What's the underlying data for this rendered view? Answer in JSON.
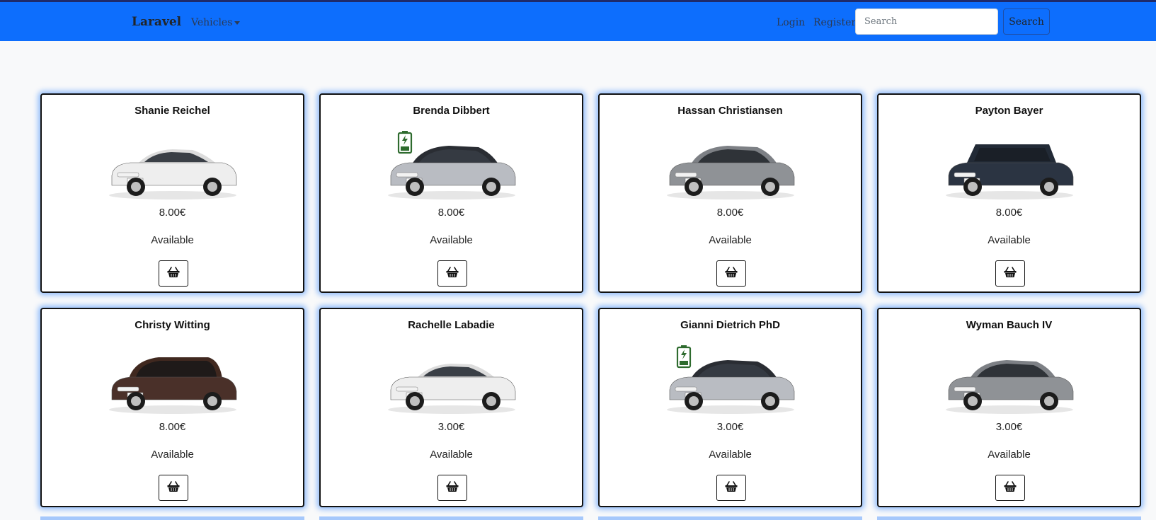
{
  "navbar": {
    "brand": "Laravel",
    "vehicles_label": "Vehicles",
    "login_label": "Login",
    "register_label": "Register",
    "search_placeholder": "Search",
    "search_button": "Search"
  },
  "colors": {
    "navbar_bg": "#0d6efd",
    "card_glow": "#0d6efd",
    "battery": "#2e6b2e"
  },
  "cards": [
    {
      "name": "Shanie Reichel",
      "price": "8.00€",
      "status": "Available",
      "car": "sedan-white",
      "electric": false
    },
    {
      "name": "Brenda Dibbert",
      "price": "8.00€",
      "status": "Available",
      "car": "hatch-bmw",
      "electric": true
    },
    {
      "name": "Hassan Christiansen",
      "price": "8.00€",
      "status": "Available",
      "car": "hatch-grey",
      "electric": false
    },
    {
      "name": "Payton Bayer",
      "price": "8.00€",
      "status": "Available",
      "car": "suv-dark",
      "electric": false
    },
    {
      "name": "Christy Witting",
      "price": "8.00€",
      "status": "Available",
      "car": "van-brown",
      "electric": false
    },
    {
      "name": "Rachelle Labadie",
      "price": "3.00€",
      "status": "Available",
      "car": "sedan-white",
      "electric": false
    },
    {
      "name": "Gianni Dietrich PhD",
      "price": "3.00€",
      "status": "Available",
      "car": "hatch-bmw",
      "electric": true
    },
    {
      "name": "Wyman Bauch IV",
      "price": "3.00€",
      "status": "Available",
      "car": "hatch-grey",
      "electric": false
    }
  ]
}
